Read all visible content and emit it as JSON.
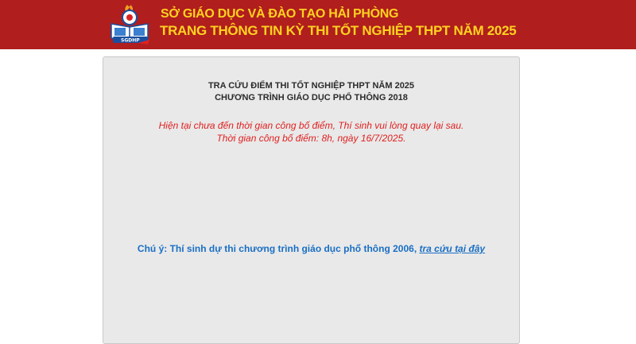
{
  "header": {
    "org_name": "SỞ GIÁO DỤC VÀ ĐÀO TẠO HẢI PHÒNG",
    "site_title": "TRANG THÔNG TIN KỲ THI TỐT NGHIỆP THPT NĂM 2025",
    "logo_text": "SGDHP",
    "logo_icon": "education-department-logo",
    "background_color": "#b01e1e",
    "text_color": "#ffd21f"
  },
  "panel": {
    "title_line1": "TRA CỨU ĐIỂM THI TỐT NGHIỆP THPT NĂM 2025",
    "title_line2": "CHƯƠNG TRÌNH GIÁO DỤC PHỔ THÔNG 2018",
    "notice_line1": "Hiện tại chưa đến thời gian công bố điểm, Thí sinh vui lòng quay lại sau.",
    "notice_line2": "Thời gian công bố điểm: 8h, ngày 16/7/2025.",
    "notice_color": "#e02020",
    "note_text": "Chú ý: Thí sinh dự thi chương trình giáo dục phổ thông 2006, ",
    "note_link": "tra cứu tại đây",
    "note_color": "#1a6fc4"
  }
}
